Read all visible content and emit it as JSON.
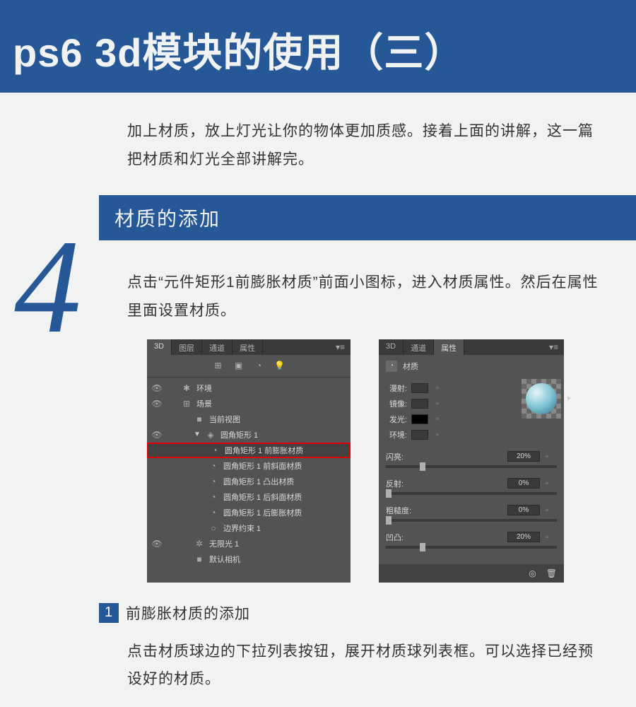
{
  "header": {
    "title": "ps6 3d模块的使用（三）"
  },
  "step_number": "4",
  "intro": "加上材质，放上灯光让你的物体更加质感。接着上面的讲解，这一篇把材质和灯光全部讲解完。",
  "sub_banner": "材质的添加",
  "body_para": "点击“元件矩形1前膨胀材质”前面小图标，进入材质属性。然后在属性里面设置材质。",
  "panel_3d": {
    "tabs": [
      "3D",
      "图层",
      "通道",
      "属性"
    ],
    "active_tab": 0,
    "tree": [
      {
        "eye": true,
        "indent": 0,
        "icon": "✱",
        "label": "环境"
      },
      {
        "eye": true,
        "indent": 0,
        "icon": "⊞",
        "label": "场景"
      },
      {
        "eye": false,
        "indent": 1,
        "icon": "■",
        "label": "当前视图"
      },
      {
        "eye": true,
        "indent": 1,
        "icon": "◈",
        "label": "圆角矩形 1",
        "arrow": "▼"
      },
      {
        "eye": false,
        "indent": 2,
        "icon": "◔",
        "label": "圆角矩形 1 前膨胀材质",
        "highlight": true
      },
      {
        "eye": false,
        "indent": 2,
        "icon": "◔",
        "label": "圆角矩形 1 前斜面材质"
      },
      {
        "eye": false,
        "indent": 2,
        "icon": "◔",
        "label": "圆角矩形 1 凸出材质"
      },
      {
        "eye": false,
        "indent": 2,
        "icon": "◔",
        "label": "圆角矩形 1 后斜面材质"
      },
      {
        "eye": false,
        "indent": 2,
        "icon": "◔",
        "label": "圆角矩形 1 后膨胀材质"
      },
      {
        "eye": false,
        "indent": 2,
        "icon": "○",
        "label": "边界约束 1"
      },
      {
        "eye": true,
        "indent": 1,
        "icon": "✲",
        "label": "无限光 1"
      },
      {
        "eye": false,
        "indent": 1,
        "icon": "■",
        "label": "默认相机"
      }
    ]
  },
  "panel_props": {
    "tabs": [
      "3D",
      "通道",
      "属性"
    ],
    "active_tab": 2,
    "header_title": "材质",
    "swatches": [
      {
        "label": "漫射:",
        "type": "gray"
      },
      {
        "label": "镜像:",
        "type": "gray"
      },
      {
        "label": "发光:",
        "type": "black"
      },
      {
        "label": "环境:",
        "type": "gray"
      }
    ],
    "sliders": [
      {
        "label": "闪亮:",
        "value": "20%",
        "pos": 20
      },
      {
        "label": "反射:",
        "value": "0%",
        "pos": 0
      },
      {
        "label": "粗糙度:",
        "value": "0%",
        "pos": 0
      },
      {
        "label": "凹凸:",
        "value": "20%",
        "pos": 20
      }
    ]
  },
  "step1": {
    "number": "1",
    "title": "前膨胀材质的添加",
    "body": "点击材质球边的下拉列表按钮，展开材质球列表框。可以选择已经预设好的材质。"
  }
}
